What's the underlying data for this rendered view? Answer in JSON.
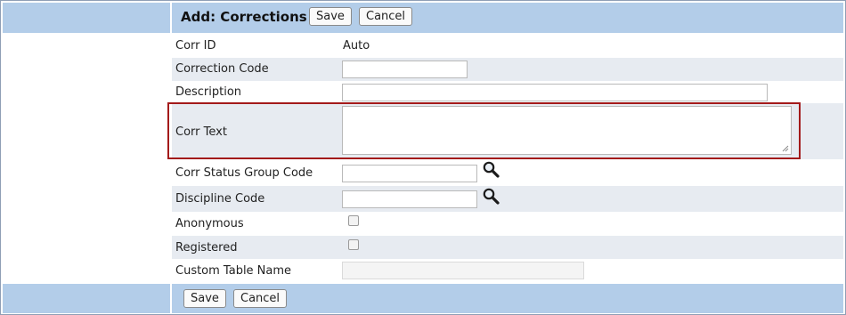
{
  "header": {
    "title": "Add: Corrections",
    "save_label": "Save",
    "cancel_label": "Cancel"
  },
  "footer": {
    "save_label": "Save",
    "cancel_label": "Cancel"
  },
  "form": {
    "corr_id": {
      "label": "Corr ID",
      "value": "Auto"
    },
    "correction_code": {
      "label": "Correction Code",
      "value": ""
    },
    "description": {
      "label": "Description",
      "value": ""
    },
    "corr_text": {
      "label": "Corr Text",
      "value": ""
    },
    "corr_status_group_code": {
      "label": "Corr Status Group Code",
      "value": "",
      "lookup_icon": "magnifier-icon"
    },
    "discipline_code": {
      "label": "Discipline Code",
      "value": "",
      "lookup_icon": "magnifier-icon"
    },
    "anonymous": {
      "label": "Anonymous",
      "checked": false
    },
    "registered": {
      "label": "Registered",
      "checked": false
    },
    "custom_table_name": {
      "label": "Custom Table Name",
      "value": "",
      "disabled": true
    }
  },
  "colors": {
    "band": "#b3cde9",
    "row_shade": "#e7ebf1",
    "highlight_border": "#a31a1a"
  }
}
